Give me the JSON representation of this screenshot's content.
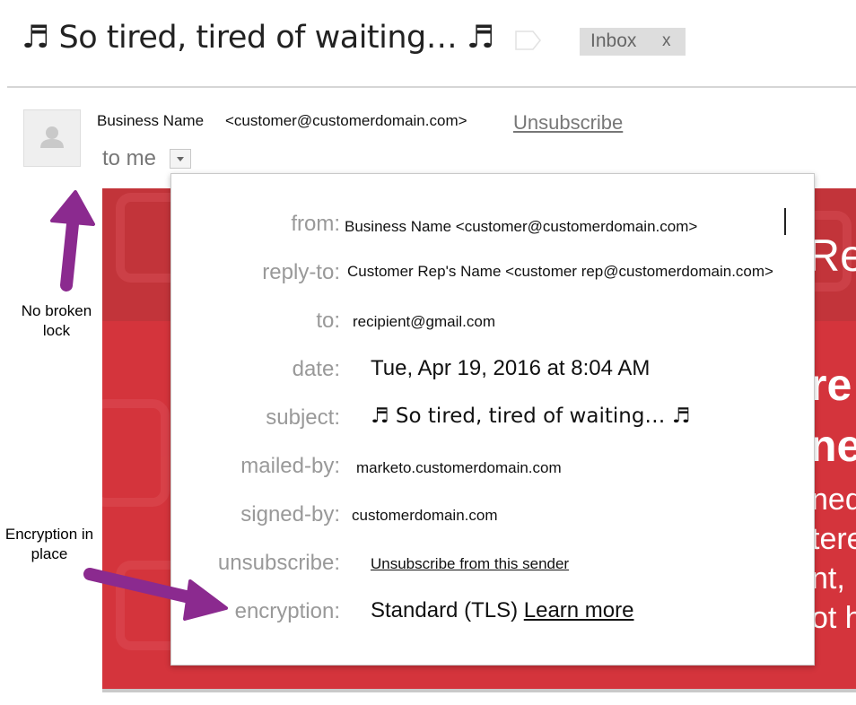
{
  "header": {
    "subject": "♬ So tired, tired of waiting… ♬",
    "label_icon": "label-tag-icon",
    "inbox_chip": {
      "label": "Inbox",
      "close": "x"
    }
  },
  "sender": {
    "avatar_icon": "person-avatar-icon",
    "name": "Business Name",
    "email": "<customer@customerdomain.com>",
    "unsubscribe": "Unsubscribe",
    "recipient_summary": "to me",
    "toggle_icon": "caret-down-icon"
  },
  "details": {
    "from": {
      "label": "from:",
      "value": "Business Name <customer@customerdomain.com>"
    },
    "reply_to": {
      "label": "reply-to:",
      "value": "Customer Rep's Name  <customer rep@customerdomain.com>"
    },
    "to": {
      "label": "to:",
      "value": "recipient@gmail.com"
    },
    "date": {
      "label": "date:",
      "value": "Tue, Apr 19, 2016 at 8:04 AM"
    },
    "subject": {
      "label": "subject:",
      "value": "♬ So tired, tired of waiting… ♬"
    },
    "mailed_by": {
      "label": "mailed-by:",
      "value": "marketo.customerdomain.com"
    },
    "signed_by": {
      "label": "signed-by:",
      "value": "customerdomain.com"
    },
    "unsubscribe": {
      "label": "unsubscribe:",
      "value": "Unsubscribe from this sender"
    },
    "encryption": {
      "label": "encryption:",
      "value": "Standard (TLS)",
      "learn_more": "Learn more"
    }
  },
  "email_body_fragments": [
    "Re",
    "re",
    "ne",
    "ned",
    "tere",
    "nt,",
    "ot h"
  ],
  "annotations": {
    "no_broken_lock": "No broken lock",
    "encryption_in_place": "Encryption in place"
  },
  "colors": {
    "banner_red": "#d4343c",
    "banner_dark_red": "#c2343a",
    "arrow_purple": "#8b2a8f",
    "label_gray": "#999999",
    "chip_gray": "#dddddd"
  }
}
